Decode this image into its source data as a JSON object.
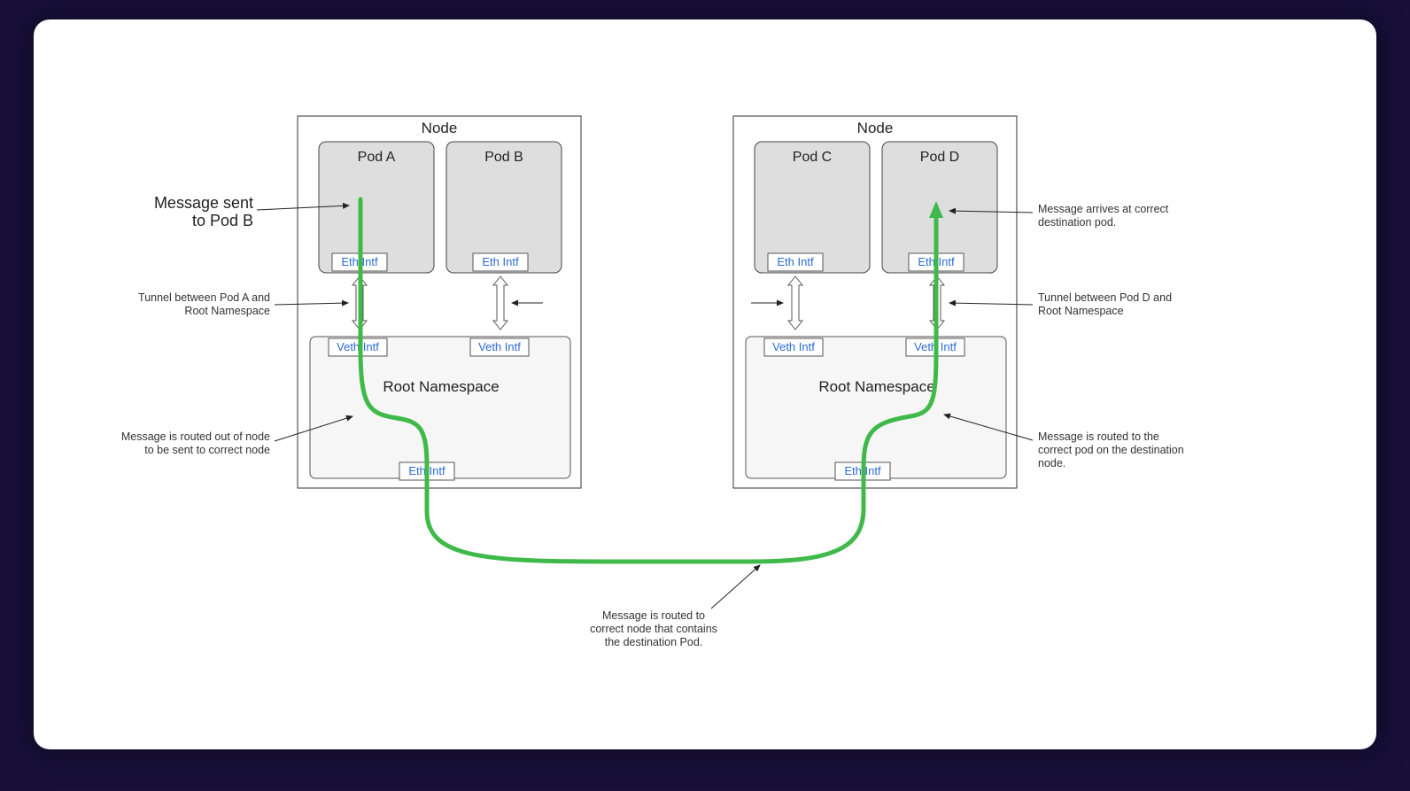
{
  "left_node": {
    "title": "Node",
    "pod_a": {
      "name": "Pod A",
      "eth": "Eth Intf",
      "veth": "Veth Intf"
    },
    "pod_b": {
      "name": "Pod B",
      "eth": "Eth Intf",
      "veth": "Veth Intf"
    },
    "root": {
      "name": "Root Namespace",
      "eth": "Eth Intf"
    }
  },
  "right_node": {
    "title": "Node",
    "pod_c": {
      "name": "Pod C",
      "eth": "Eth Intf",
      "veth": "Veth Intf"
    },
    "pod_d": {
      "name": "Pod D",
      "eth": "Eth Intf",
      "veth": "Veth Intf"
    },
    "root": {
      "name": "Root Namespace",
      "eth": "Eth Intf"
    }
  },
  "annotations": {
    "sent": {
      "l1": "Message sent",
      "l2": "to Pod B"
    },
    "tunnel_left": {
      "l1": "Tunnel between Pod A and",
      "l2": "Root Namespace"
    },
    "route_out": {
      "l1": "Message is routed out of node",
      "l2": "to be sent to correct node"
    },
    "route_between": {
      "l1": "Message is routed to",
      "l2": "correct node that contains",
      "l3": "the destination Pod."
    },
    "route_in": {
      "l1": "Message is routed to the",
      "l2": "correct pod on the destination",
      "l3": "node."
    },
    "tunnel_right": {
      "l1": "Tunnel between Pod D and",
      "l2": "Root Namespace"
    },
    "arrive": {
      "l1": "Message arrives at correct",
      "l2": "destination pod."
    }
  }
}
